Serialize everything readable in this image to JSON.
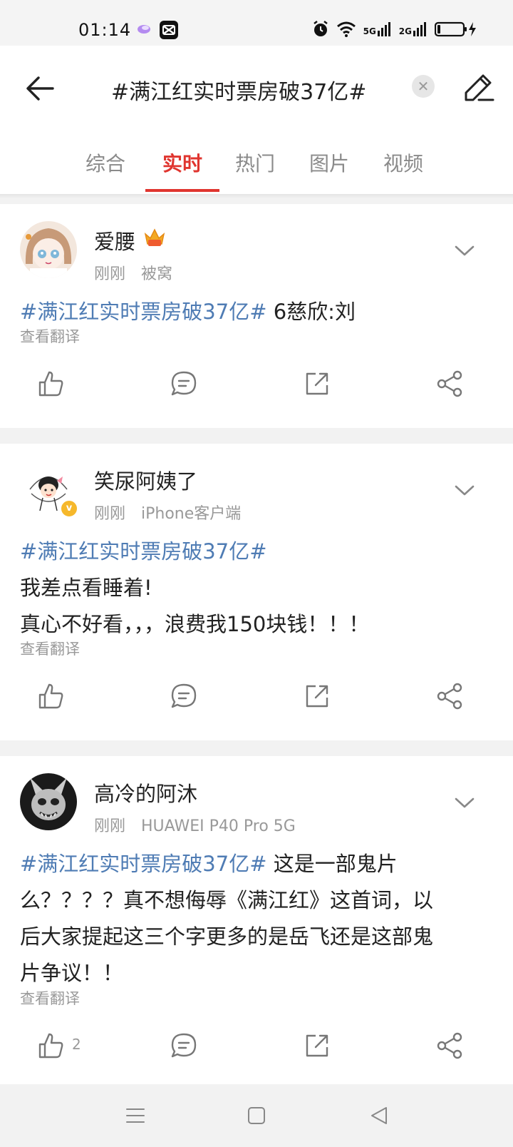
{
  "status_bar": {
    "time": "01:14",
    "network_1": "5G",
    "network_2": "2G"
  },
  "header": {
    "search_query": "#满江红实时票房破37亿#",
    "clear_icon": "close-icon",
    "back_icon": "back-arrow-icon",
    "edit_icon": "pencil-icon"
  },
  "tabs": [
    {
      "label": "综合",
      "active": false
    },
    {
      "label": "实时",
      "active": true
    },
    {
      "label": "热门",
      "active": false
    },
    {
      "label": "图片",
      "active": false
    },
    {
      "label": "视频",
      "active": false
    }
  ],
  "accent_color": "#e0352f",
  "hashtag_color": "#4f7cb4",
  "posts": [
    {
      "username": "爱腰",
      "time": "刚刚",
      "source": "被窝",
      "hashtag": "#满江红实时票房破37亿#",
      "lines": [
        " 6慈欣:刘"
      ],
      "translate": "查看翻译",
      "like_count": ""
    },
    {
      "username": "笑尿阿姨了",
      "time": "刚刚",
      "source": "iPhone客户端",
      "hashtag": "#满江红实时票房破37亿#",
      "lines": [
        "我差点看睡着!",
        "真心不好看，，，浪费我150块钱！！！"
      ],
      "translate": "查看翻译",
      "like_count": ""
    },
    {
      "username": "高冷的阿沐",
      "time": "刚刚",
      "source": "HUAWEI P40 Pro 5G",
      "hashtag": "#满江红实时票房破37亿#",
      "lines": [
        " 这是一部鬼片",
        "么？？？？真不想侮辱《满江红》这首词，以",
        "后大家提起这三个字更多的是岳飞还是这部鬼",
        "片争议！！"
      ],
      "translate": "查看翻译",
      "like_count": "2"
    }
  ]
}
